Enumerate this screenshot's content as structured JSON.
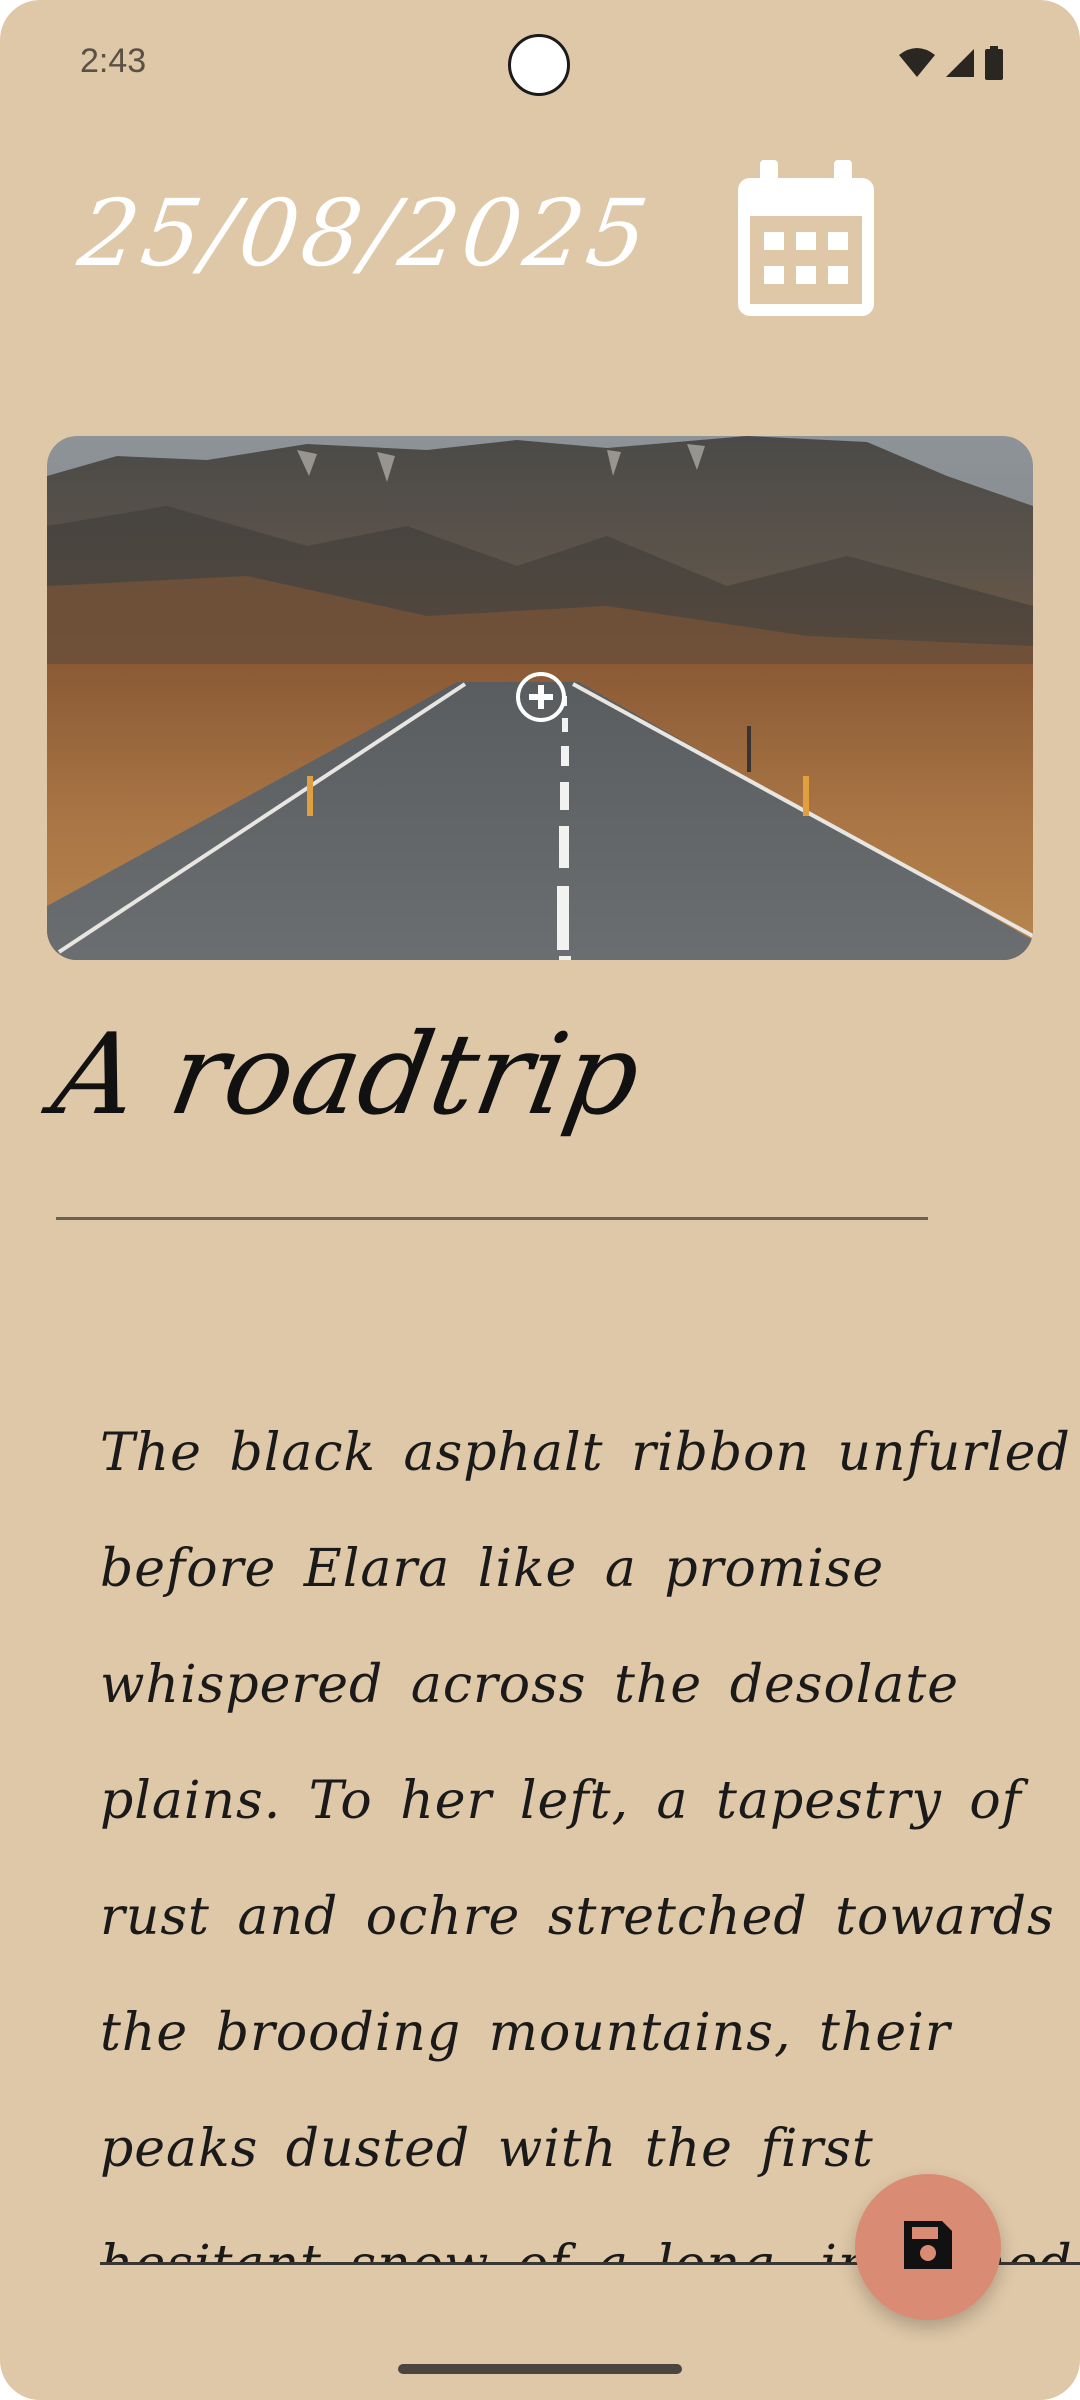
{
  "status_bar": {
    "time": "2:43"
  },
  "header": {
    "date": "25/08/2025"
  },
  "entry": {
    "title": "A roadtrip",
    "body": "The black asphalt ribbon unfurled before Elara like a promise whispered across the desolate plains. To her left, a tapestry of rust and ochre stretched towards the brooding mountains, their peaks dusted with the first hesitant snow of a long, imagined winter. The air, though still, hummed with a stran"
  },
  "icons": {
    "calendar": "calendar-icon",
    "add_photo": "add-circle-icon",
    "save": "save-floppy-icon",
    "wifi": "wifi-icon",
    "signal": "cell-signal-icon",
    "battery": "battery-icon"
  },
  "colors": {
    "background": "#dfc8a8",
    "fab": "#d98b73",
    "date_text": "#ffffff",
    "title_text": "#111111"
  }
}
